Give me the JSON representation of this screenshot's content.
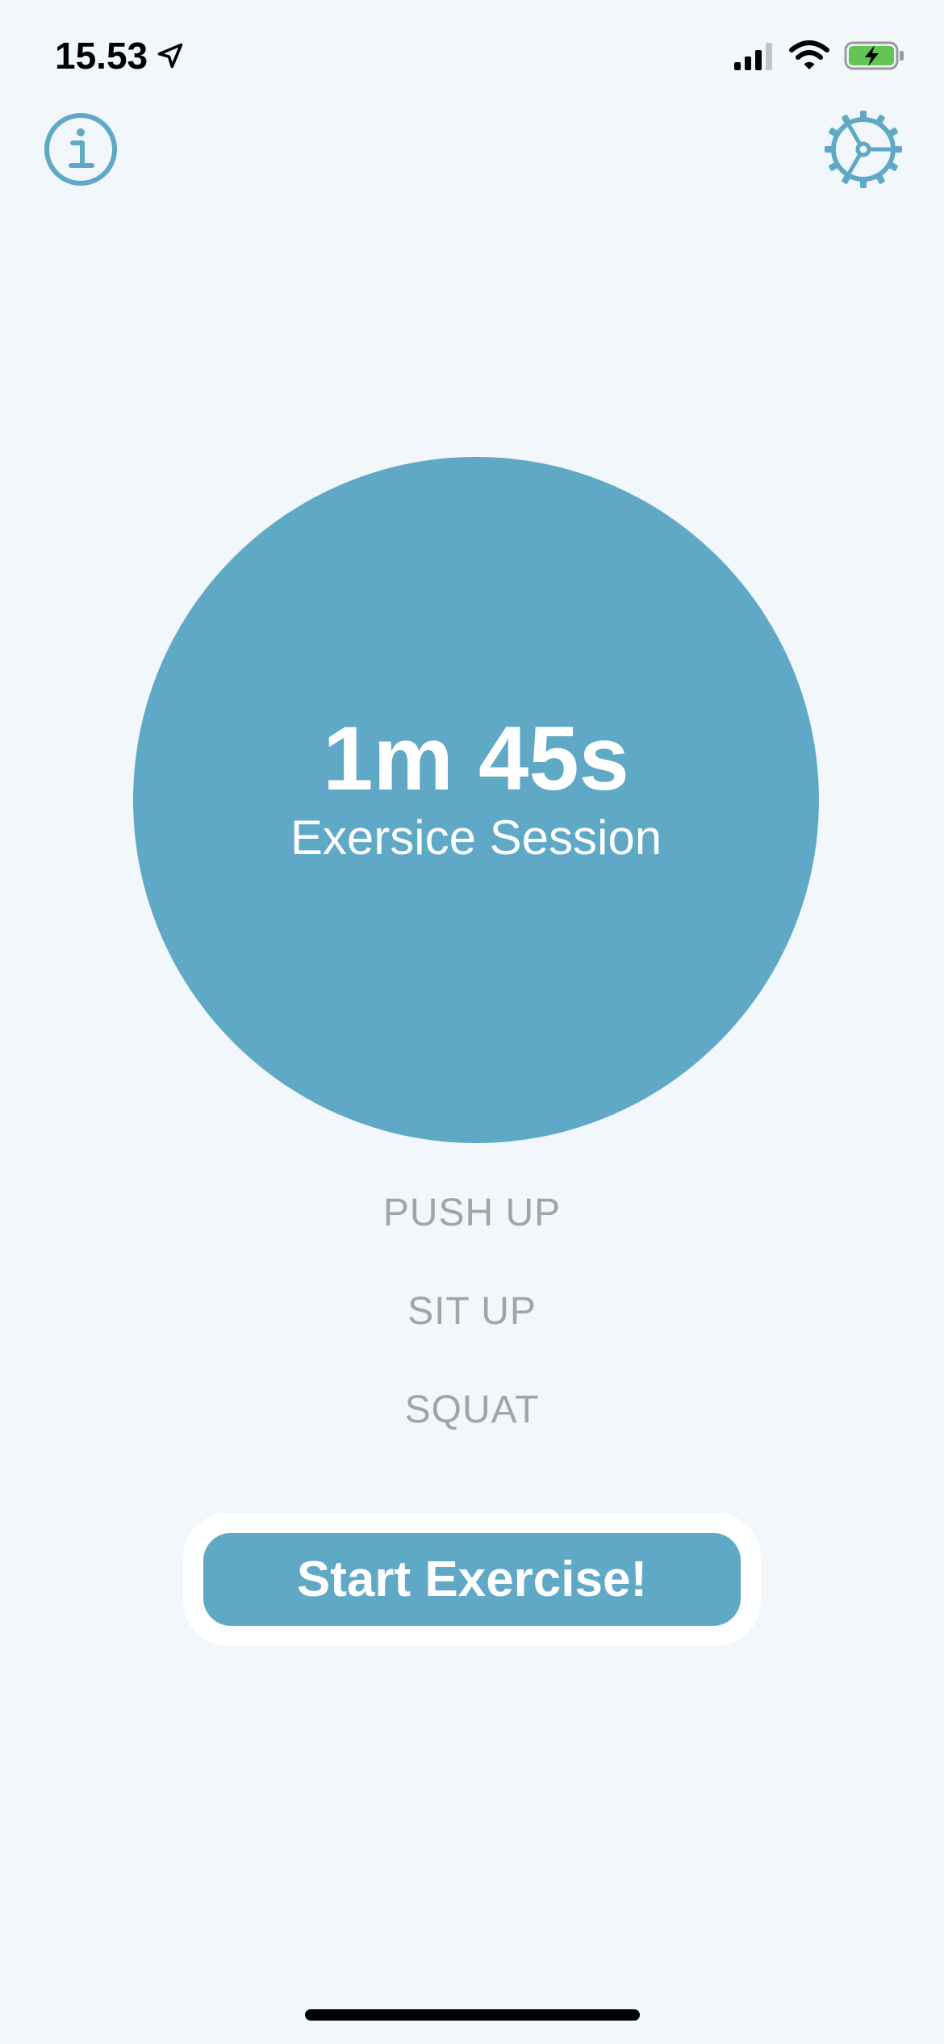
{
  "status_bar": {
    "time": "15.53",
    "icons": [
      "location-arrow-icon",
      "cellular-signal-icon",
      "wifi-icon",
      "battery-charging-icon"
    ]
  },
  "header": {
    "left_icon": "info-icon",
    "right_icon": "gear-icon"
  },
  "timer": {
    "value": "1m 45s",
    "caption": "Exersice Session"
  },
  "exercises": [
    "PUSH UP",
    "SIT UP",
    "SQUAT"
  ],
  "start_button": {
    "label": "Start Exercise!"
  },
  "colors": {
    "background": "#f1f7fa",
    "accent": "#5fa8c6",
    "muted_text": "#a4a4a4",
    "battery": "#62c554"
  }
}
